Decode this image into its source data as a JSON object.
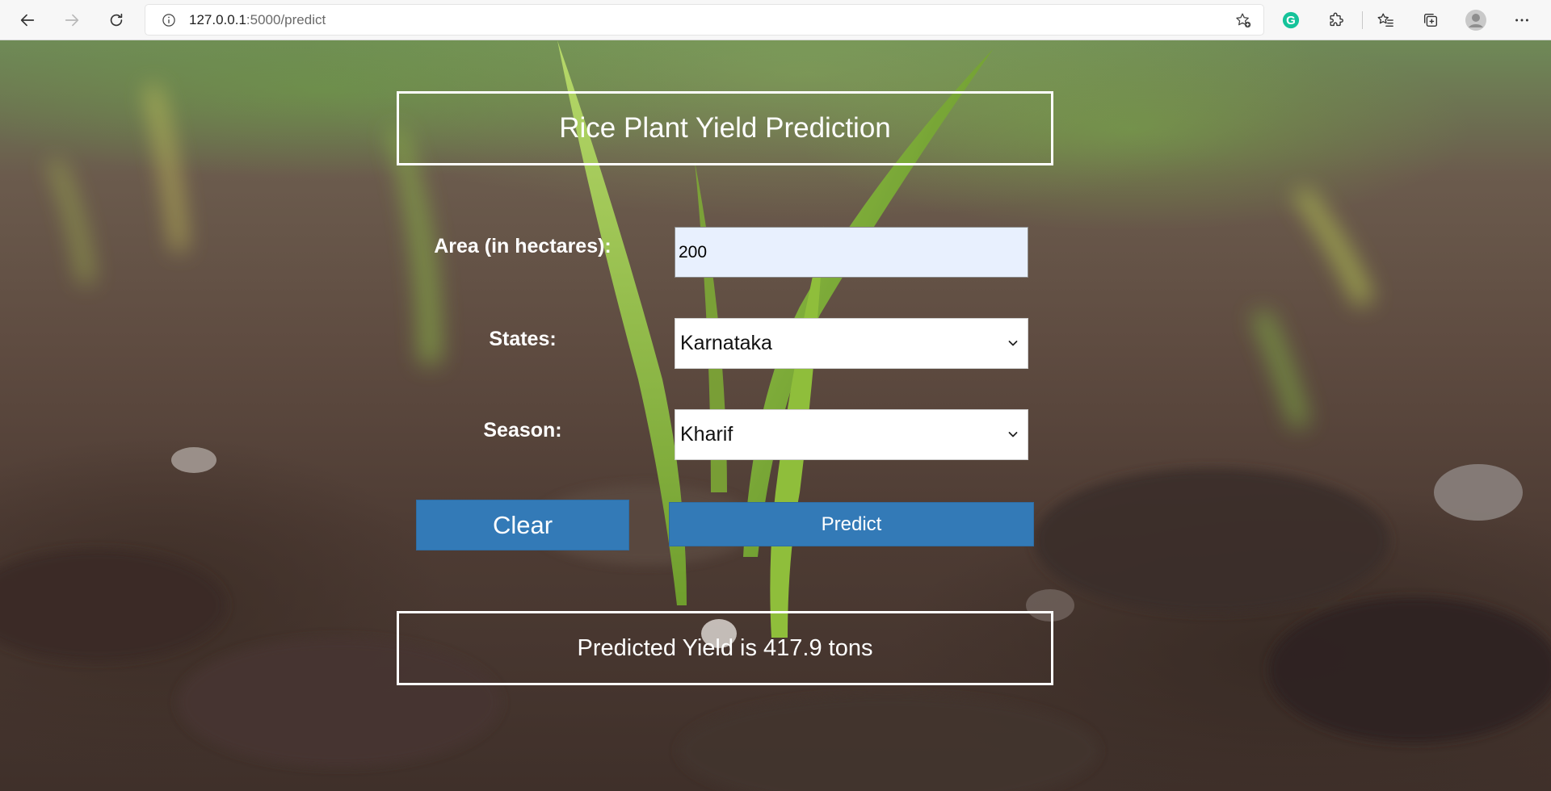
{
  "browser": {
    "url_host": "127.0.0.1",
    "url_path": ":5000/predict",
    "icons": {
      "back": "back-arrow-icon",
      "forward": "forward-arrow-icon",
      "refresh": "refresh-icon",
      "site_info": "info-icon",
      "add_favorite": "star-plus-icon",
      "grammarly": "grammarly-icon",
      "extensions": "puzzle-icon",
      "favorites": "favorites-icon",
      "collections": "collections-icon",
      "profile": "profile-icon",
      "more": "more-icon"
    },
    "grammarly_letter": "G",
    "accent_grammarly": "#15c39a"
  },
  "page": {
    "title": "Rice Plant Yield Prediction",
    "form": {
      "area_label": "Area (in hectares):",
      "area_value": "200",
      "state_label": "States:",
      "state_value": "Karnataka",
      "season_label": "Season:",
      "season_value": "Kharif"
    },
    "buttons": {
      "clear": "Clear",
      "predict": "Predict"
    },
    "result": "Predicted Yield is 417.9 tons",
    "colors": {
      "button": "#337ab7",
      "input_autofill": "#e8f0fe"
    }
  }
}
